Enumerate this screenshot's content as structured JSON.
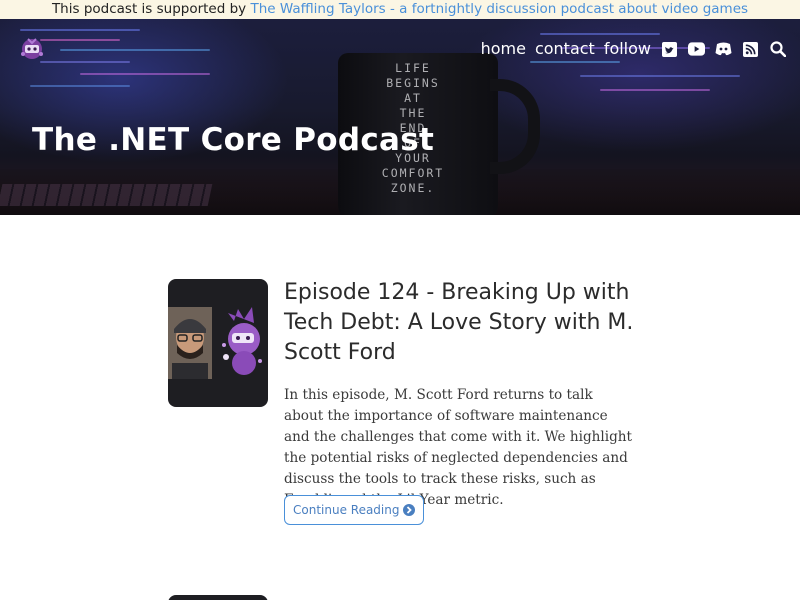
{
  "sponsor": {
    "prefix": "This podcast is supported by",
    "link_text": "The Waffling Taylors - a fortnightly discussion podcast about video games"
  },
  "header": {
    "title": "The .NET Core Podcast",
    "nav": {
      "home": "home",
      "contact": "contact",
      "follow": "follow"
    },
    "icons": [
      "twitter-icon",
      "youtube-icon",
      "discord-icon",
      "rss-icon",
      "search-icon"
    ]
  },
  "hero_image": {
    "mug_text": [
      "LIFE",
      "BEGINS",
      "AT",
      "THE",
      "END",
      "OF",
      "YOUR",
      "COMFORT",
      "ZONE."
    ]
  },
  "episode": {
    "title": "Episode 124 - Breaking Up with Tech Debt: A Love Story with M. Scott Ford",
    "summary": "In this episode, M. Scott Ford returns to talk about the importance of software maintenance and the challenges that come with it. We highlight the potential risks of neglected dependencies and discuss the tools to track these risks, such as Freshli, and the LibYear metric.",
    "button_label": "Continue Reading"
  },
  "colors": {
    "accent": "#4a90d9",
    "sponsor_bg": "#fbf6e4",
    "text": "#2b2b2b"
  }
}
